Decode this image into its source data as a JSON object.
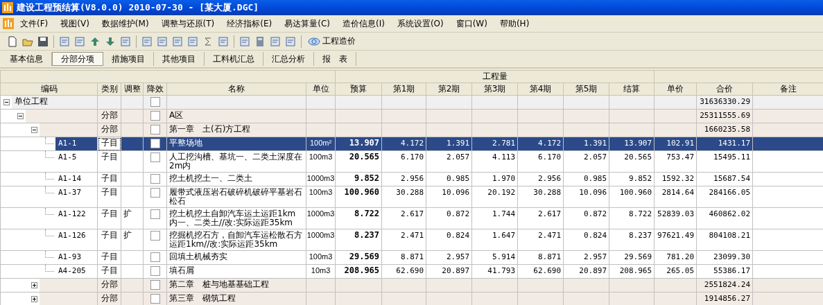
{
  "window": {
    "title": "建设工程预结算(V8.0.0) 2010-07-30 - [某大厦.DGC]"
  },
  "menu": [
    "文件(F)",
    "视图(V)",
    "数据维护(M)",
    "调整与还原(T)",
    "经济指标(E)",
    "易达算量(C)",
    "造价信息(I)",
    "系统设置(O)",
    "窗口(W)",
    "帮助(H)"
  ],
  "toolbar": {
    "link_label": "工程造价"
  },
  "tabs": [
    {
      "label": "基本信息",
      "selected": false
    },
    {
      "label": "分部分项",
      "selected": true
    },
    {
      "label": "措施项目",
      "selected": false
    },
    {
      "label": "其他项目",
      "selected": false
    },
    {
      "label": "工料机汇总",
      "selected": false
    },
    {
      "label": "汇总分析",
      "selected": false
    },
    {
      "label": "报　表",
      "selected": false
    }
  ],
  "table": {
    "group_header": "工程量",
    "columns": [
      "编码",
      "类别",
      "调整",
      "降效",
      "名称",
      "单位",
      "预算",
      "第1期",
      "第2期",
      "第3期",
      "第4期",
      "第5期",
      "结算",
      "单价",
      "合价",
      "备注"
    ],
    "rows": [
      {
        "kind": "unit",
        "code": "单位工程",
        "derate": false,
        "total": "31636330.29",
        "expanded": true,
        "selected": false,
        "children": [
          {
            "kind": "section",
            "type": "分部",
            "derate": false,
            "name": "A区",
            "total": "25311555.69",
            "expanded": true,
            "selected": false,
            "children": [
              {
                "kind": "section",
                "type": "分部",
                "derate": false,
                "name": "第一章　土(石)方工程",
                "total": "1660235.58",
                "expanded": true,
                "selected": false,
                "children": [
                  {
                    "kind": "item",
                    "code": "A1-1",
                    "type": "子目",
                    "derate": false,
                    "name": "平整场地",
                    "unit": "100m²",
                    "budget": "13.907",
                    "periods": [
                      "4.172",
                      "1.391",
                      "2.781",
                      "4.172",
                      "1.391"
                    ],
                    "settlement": "13.907",
                    "unit_price": "102.91",
                    "total": "1431.17",
                    "selected": true
                  },
                  {
                    "kind": "item",
                    "code": "A1-5",
                    "type": "子目",
                    "derate": false,
                    "name": "人工挖沟槽、基坑一、二类土深度在2m内",
                    "unit": "100m3",
                    "budget": "20.565",
                    "periods": [
                      "6.170",
                      "2.057",
                      "4.113",
                      "6.170",
                      "2.057"
                    ],
                    "settlement": "20.565",
                    "unit_price": "753.47",
                    "total": "15495.11",
                    "selected": false
                  },
                  {
                    "kind": "item",
                    "code": "A1-14",
                    "type": "子目",
                    "derate": false,
                    "name": "挖土机挖土一、二类土",
                    "unit": "1000m3",
                    "budget": "9.852",
                    "periods": [
                      "2.956",
                      "0.985",
                      "1.970",
                      "2.956",
                      "0.985"
                    ],
                    "settlement": "9.852",
                    "unit_price": "1592.32",
                    "total": "15687.54",
                    "selected": false
                  },
                  {
                    "kind": "item",
                    "code": "A1-37",
                    "type": "子目",
                    "derate": false,
                    "name": "履带式液压岩石破碎机破碎平基岩石松石",
                    "unit": "100m3",
                    "budget": "100.960",
                    "periods": [
                      "30.288",
                      "10.096",
                      "20.192",
                      "30.288",
                      "10.096"
                    ],
                    "settlement": "100.960",
                    "unit_price": "2814.64",
                    "total": "284166.05",
                    "selected": false
                  },
                  {
                    "kind": "item",
                    "code": "A1-122",
                    "type": "子目",
                    "adjust": "扩",
                    "derate": false,
                    "name": "挖土机挖土自卸汽车运土运距1km内一、二类土//改:实际运距35km",
                    "unit": "1000m3",
                    "budget": "8.722",
                    "periods": [
                      "2.617",
                      "0.872",
                      "1.744",
                      "2.617",
                      "0.872"
                    ],
                    "settlement": "8.722",
                    "unit_price": "52839.03",
                    "total": "460862.02",
                    "selected": false
                  },
                  {
                    "kind": "item",
                    "code": "A1-126",
                    "type": "子目",
                    "adjust": "扩",
                    "derate": false,
                    "name": "挖掘机挖石方，自卸汽车运松散石方运距1km//改:实际运距35km",
                    "unit": "1000m3",
                    "budget": "8.237",
                    "periods": [
                      "2.471",
                      "0.824",
                      "1.647",
                      "2.471",
                      "0.824"
                    ],
                    "settlement": "8.237",
                    "unit_price": "97621.49",
                    "total": "804108.21",
                    "selected": false
                  },
                  {
                    "kind": "item",
                    "code": "A1-93",
                    "type": "子目",
                    "derate": false,
                    "name": "回填土机械夯实",
                    "unit": "100m3",
                    "budget": "29.569",
                    "periods": [
                      "8.871",
                      "2.957",
                      "5.914",
                      "8.871",
                      "2.957"
                    ],
                    "settlement": "29.569",
                    "unit_price": "781.20",
                    "total": "23099.30",
                    "selected": false
                  },
                  {
                    "kind": "item",
                    "code": "A4-205",
                    "type": "子目",
                    "derate": false,
                    "name": "填石屑",
                    "unit": "10m3",
                    "budget": "208.965",
                    "periods": [
                      "62.690",
                      "20.897",
                      "41.793",
                      "62.690",
                      "20.897"
                    ],
                    "settlement": "208.965",
                    "unit_price": "265.05",
                    "total": "55386.17",
                    "selected": false
                  }
                ]
              },
              {
                "kind": "section",
                "type": "分部",
                "derate": false,
                "name": "第二章　桩与地基基础工程",
                "total": "2551824.24",
                "expanded": false,
                "selected": false
              },
              {
                "kind": "section",
                "type": "分部",
                "derate": false,
                "name": "第三章　砌筑工程",
                "total": "1914856.27",
                "expanded": false,
                "selected": false
              }
            ]
          }
        ]
      }
    ]
  }
}
